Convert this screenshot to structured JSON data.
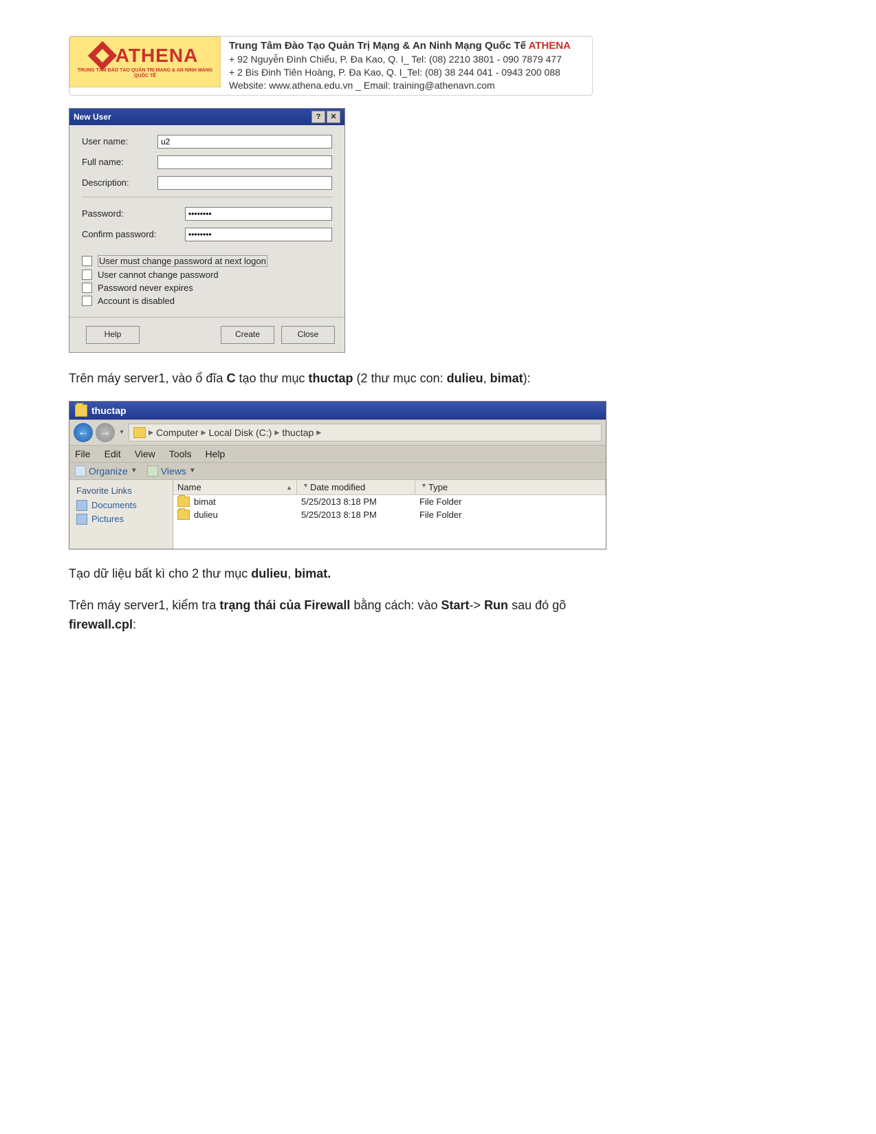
{
  "letterhead": {
    "logo_name": "ATHENA",
    "logo_sub": "TRUNG TÂM ĐÀO TẠO QUẢN TRỊ MẠNG & AN NINH MẠNG QUỐC TẾ",
    "line1_a": "Trung Tâm Đào Tạo Quản Trị Mạng & An Ninh Mạng Quốc Tế ",
    "line1_brand": "ATHENA",
    "line2": "+  92 Nguyễn Đình Chiểu, P. Đa Kao, Q. I_ Tel: (08) 2210 3801 -  090 7879 477",
    "line3": "+  2 Bis Đinh Tiên Hoàng, P. Đa Kao, Q. I_Tel: (08) 38 244 041 - 0943 200 088",
    "line4": "Website:  www.athena.edu.vn     _       Email: training@athenavn.com"
  },
  "dialog": {
    "title": "New User",
    "help_glyph": "?",
    "close_glyph": "✕",
    "labels": {
      "user_name": "User name:",
      "full_name": "Full name:",
      "description": "Description:",
      "password": "Password:",
      "confirm_password": "Confirm password:"
    },
    "values": {
      "user_name": "u2",
      "full_name": "",
      "description": "",
      "password": "••••••••",
      "confirm_password": "••••••••"
    },
    "checkboxes": {
      "must_change": "User must change password at next logon",
      "cannot_change": "User cannot change password",
      "never_expires": "Password never expires",
      "disabled": "Account is disabled"
    },
    "buttons": {
      "help": "Help",
      "create": "Create",
      "close": "Close"
    }
  },
  "para1": {
    "a": "Trên máy server1, vào ổ đĩa ",
    "b": "C",
    "c": " tạo thư mục ",
    "d": "thuctap",
    "e": " (2 thư mục con: ",
    "f": "dulieu",
    "g": ", ",
    "h": "bimat",
    "i": "):"
  },
  "explorer": {
    "title": "thuctap",
    "breadcrumb": [
      "Computer",
      "Local Disk (C:)",
      "thuctap"
    ],
    "menu": [
      "File",
      "Edit",
      "View",
      "Tools",
      "Help"
    ],
    "toolbar": {
      "organize": "Organize",
      "views": "Views"
    },
    "sidebar": {
      "heading": "Favorite Links",
      "items": [
        "Documents",
        "Pictures"
      ]
    },
    "columns": {
      "name": "Name",
      "date": "Date modified",
      "type": "Type"
    },
    "rows": [
      {
        "name": "bimat",
        "date": "5/25/2013 8:18 PM",
        "type": "File Folder"
      },
      {
        "name": "dulieu",
        "date": "5/25/2013 8:18 PM",
        "type": "File Folder"
      }
    ]
  },
  "para2": {
    "a": "Tạo dữ liệu bất kì cho 2 thư mục ",
    "b": "dulieu",
    "c": ", ",
    "d": "bimat."
  },
  "para3": {
    "a": "Trên máy server1, kiểm tra ",
    "b": "trạng thái của Firewall",
    "c": " bằng cách: vào ",
    "d": "Start",
    "e": "-> ",
    "f": "Run",
    "g": " sau đó gõ ",
    "h": "firewall.cpl",
    "i": ":"
  }
}
